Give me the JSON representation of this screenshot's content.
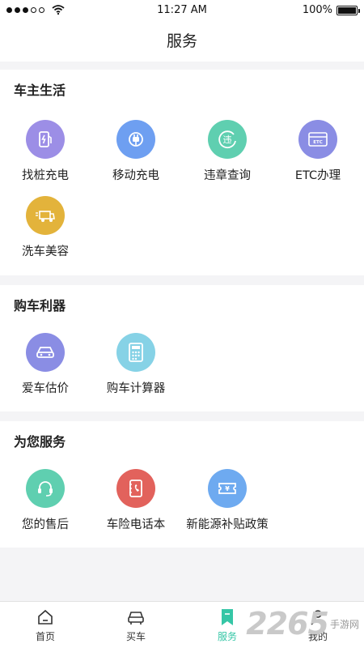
{
  "status_bar": {
    "time": "11:27 AM",
    "battery": "100%"
  },
  "header": {
    "title": "服务"
  },
  "sections": [
    {
      "title": "车主生活",
      "items": [
        {
          "label": "找桩充电",
          "icon": "charging-pile-icon",
          "color": "#9c8ee6"
        },
        {
          "label": "移动充电",
          "icon": "plug-icon",
          "color": "#6e9ff1"
        },
        {
          "label": "违章查询",
          "icon": "violation-icon",
          "color": "#5fcfb0"
        },
        {
          "label": "ETC办理",
          "icon": "etc-card-icon",
          "color": "#8a8de4"
        },
        {
          "label": "洗车美容",
          "icon": "car-wash-icon",
          "color": "#e3b33b"
        }
      ]
    },
    {
      "title": "购车利器",
      "items": [
        {
          "label": "爱车估价",
          "icon": "car-valuation-icon",
          "color": "#8a8de4"
        },
        {
          "label": "购车计算器",
          "icon": "calculator-icon",
          "color": "#86d2e6"
        }
      ]
    },
    {
      "title": "为您服务",
      "items": [
        {
          "label": "您的售后",
          "icon": "headset-icon",
          "color": "#5fcfb0"
        },
        {
          "label": "车险电话本",
          "icon": "phonebook-icon",
          "color": "#e2625c"
        },
        {
          "label": "新能源补贴政策",
          "icon": "subsidy-ticket-icon",
          "color": "#6eaaf0"
        }
      ]
    }
  ],
  "tabs": [
    {
      "label": "首页",
      "icon": "home-icon"
    },
    {
      "label": "买车",
      "icon": "car-icon"
    },
    {
      "label": "服务",
      "icon": "bookmark-icon",
      "active": true
    },
    {
      "label": "我的",
      "icon": "profile-icon"
    }
  ],
  "watermark": {
    "number": "2265",
    "site": "手游网"
  },
  "colors": {
    "accent": "#35c6a6",
    "page_bg": "#f4f4f6"
  }
}
